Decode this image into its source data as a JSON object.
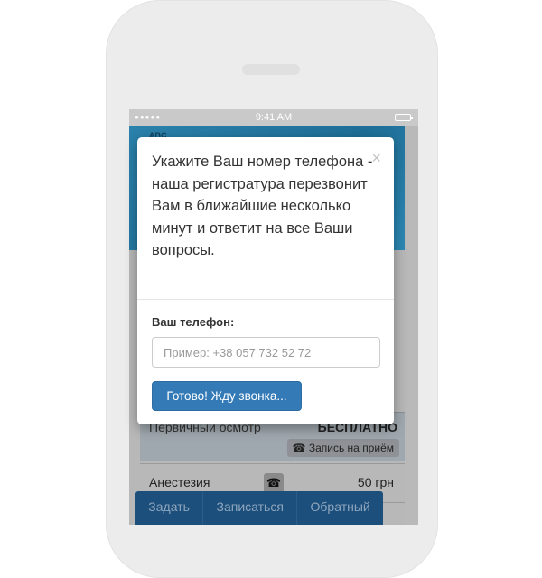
{
  "status_bar": {
    "signal_dots": "●●●●●",
    "time": "9:41 AM"
  },
  "background_app": {
    "logo_text": "ABC",
    "price_list": [
      {
        "name": "Первичный осмотр",
        "price": "БЕСПЛАТНО",
        "action": "Запись на приём",
        "action_icon": "phone-icon"
      },
      {
        "name": "Анестезия",
        "price": "50 грн",
        "action_icon": "phone-icon"
      }
    ],
    "bottom_tabs": [
      "Задать",
      "Записаться",
      "Обратный"
    ]
  },
  "modal": {
    "close_glyph": "×",
    "message": "Укажите Ваш номер телефона - наша регистратура перезвонит Вам в ближайшие несколько минут и ответит на все Ваши вопросы.",
    "phone_label": "Ваш телефон:",
    "phone_value": "",
    "phone_placeholder": "Пример: +38 057 732 52 72",
    "submit_label": "Готово! Жду звонка..."
  },
  "colors": {
    "primary_button": "#337ab7",
    "overlay": "#b9b9b9",
    "tabs_bar": "#1d4f7c"
  }
}
